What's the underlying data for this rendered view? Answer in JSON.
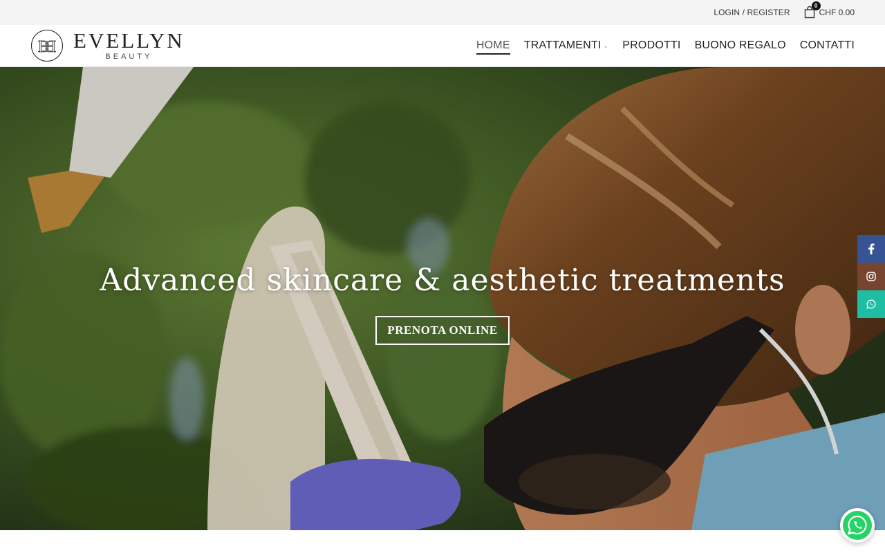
{
  "topbar": {
    "login_label": "LOGIN / REGISTER",
    "cart_count": "0",
    "cart_total": "CHF 0.00"
  },
  "header": {
    "logo_name": "EVELLYN",
    "logo_sub": "BEAUTY",
    "nav": [
      {
        "label": "HOME",
        "active": true
      },
      {
        "label": "TRATTAMENTI",
        "has_dropdown": true
      },
      {
        "label": "PRODOTTI"
      },
      {
        "label": "BUONO REGALO"
      },
      {
        "label": "CONTATTI"
      }
    ]
  },
  "hero": {
    "title": "Advanced skincare & aesthetic  treatments",
    "cta_label": "PRENOTA ONLINE"
  },
  "social": [
    {
      "icon": "facebook-icon",
      "color": "#365493"
    },
    {
      "icon": "instagram-icon",
      "color": "#774430"
    },
    {
      "icon": "whatsapp-icon",
      "color": "#1ebea5"
    }
  ],
  "floating_whatsapp": {
    "icon": "whatsapp-icon",
    "color": "#25d366"
  },
  "colors": {
    "topbar_bg": "#f4f4f4",
    "header_bg": "#ffffff"
  }
}
